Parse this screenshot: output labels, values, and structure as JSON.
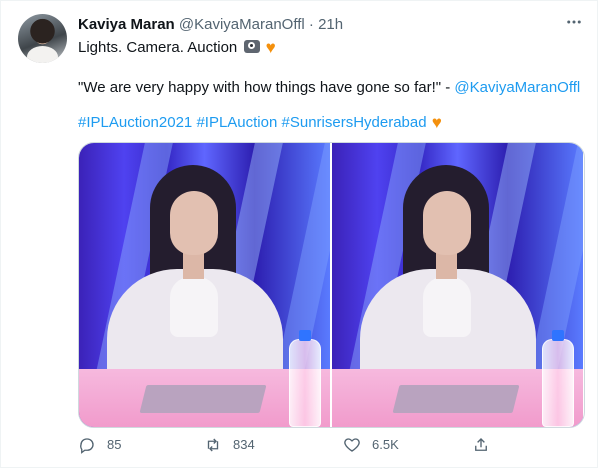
{
  "tweet": {
    "display_name": "Kaviya Maran",
    "handle": "@KaviyaMaranOffl",
    "separator": "·",
    "time": "21h",
    "line1_text": "Lights. Camera. Auction",
    "quote": "\"We are very happy with how things have gone so far!\" -",
    "quote_mention": "@KaviyaMaranOffl",
    "hashtag1": "#IPLAuction2021",
    "hashtag2": "#IPLAuction",
    "hashtag3": "#SunrisersHyderabad",
    "orange_heart_icon": "orange-heart-icon",
    "camera_icon": "camera-icon"
  },
  "actions": {
    "reply_count": "85",
    "retweet_count": "834",
    "like_count": "6.5K"
  },
  "colors": {
    "link": "#1d9bf0",
    "text": "#0f1419",
    "muted": "#536471",
    "heart": "#f4900c"
  }
}
